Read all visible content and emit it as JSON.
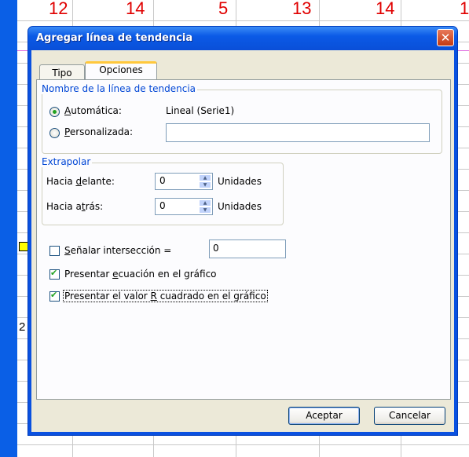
{
  "background": {
    "column_numbers": [
      "12",
      "14",
      "5",
      "13",
      "14",
      "1"
    ],
    "cell_value": "2"
  },
  "dialog": {
    "title": "Agregar línea de tendencia",
    "tabs": [
      {
        "label": "Tipo",
        "active": false
      },
      {
        "label": "Opciones",
        "active": true
      }
    ],
    "name_group": {
      "legend": "Nombre de la línea de tendencia",
      "automatic": {
        "pre": "",
        "mnemonic": "A",
        "post": "utomática:",
        "value": "Lineal (Serie1)",
        "selected": true
      },
      "custom": {
        "pre": "",
        "mnemonic": "P",
        "post": "ersonalizada:",
        "value": "",
        "selected": false
      }
    },
    "extrapolate": {
      "legend": "Extrapolar",
      "forward": {
        "pre": "Hacia ",
        "mnemonic": "d",
        "post": "elante:",
        "value": "0",
        "units": "Unidades"
      },
      "backward": {
        "pre": "Hacia a",
        "mnemonic": "t",
        "post": "rás:",
        "value": "0",
        "units": "Unidades"
      }
    },
    "intercept": {
      "pre": "",
      "mnemonic": "S",
      "post": "eñalar intersección =",
      "value": "0",
      "checked": false
    },
    "show_equation": {
      "pre": "Presentar ",
      "mnemonic": "e",
      "post": "cuación en el gráfico",
      "checked": true
    },
    "show_r2": {
      "pre": "Presentar el valor ",
      "mnemonic": "R",
      "post": " cuadrado en el gráfico",
      "checked": true
    },
    "ok_label": "Aceptar",
    "cancel_label": "Cancelar"
  },
  "colors": {
    "title_bar": "#0a5fe6",
    "dialog_face": "#ece9d8",
    "group_legend": "#0046d5",
    "background_numbers": "#e00000"
  }
}
